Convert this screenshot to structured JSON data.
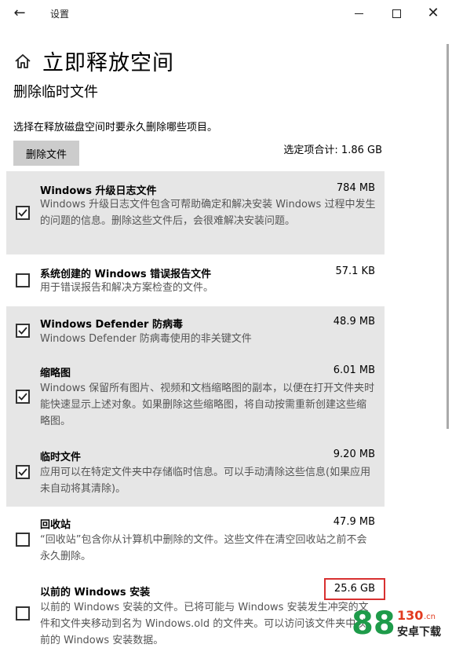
{
  "window": {
    "title": "设置",
    "back_glyph": "←",
    "close_glyph": "✕"
  },
  "page": {
    "title": "立即释放空间",
    "section": "删除临时文件",
    "instruction": "选择在释放磁盘空间时要永久删除哪些项目。",
    "delete_button": "删除文件",
    "total_label": "选定项合计: 1.86 GB"
  },
  "items": [
    {
      "name": "Windows 升级日志文件",
      "size": "784 MB",
      "checked": true,
      "description": "Windows 升级日志文件包含可帮助确定和解决安装 Windows 过程中发生的问题的信息。删除这些文件后，会很难解决安装问题。"
    },
    {
      "name": "系统创建的 Windows 错误报告文件",
      "size": "57.1 KB",
      "checked": false,
      "description": "用于错误报告和解决方案检查的文件。"
    },
    {
      "name": "Windows Defender 防病毒",
      "size": "48.9 MB",
      "checked": true,
      "description": "Windows Defender 防病毒使用的非关键文件"
    },
    {
      "name": "缩略图",
      "size": "6.01 MB",
      "checked": true,
      "description": "Windows 保留所有图片、视频和文档缩略图的副本，以便在打开文件夹时能快速显示上述对象。如果删除这些缩略图，将自动按需重新创建这些缩略图。"
    },
    {
      "name": "临时文件",
      "size": "9.20 MB",
      "checked": true,
      "description": "应用可以在特定文件夹中存储临时信息。可以手动清除这些信息(如果应用未自动将其清除)。"
    },
    {
      "name": "回收站",
      "size": "47.9 MB",
      "checked": false,
      "description": "“回收站”包含你从计算机中删除的文件。这些文件在清空回收站之前不会永久删除。"
    },
    {
      "name": "以前的 Windows 安装",
      "size": "25.6 GB",
      "checked": false,
      "description": "以前的 Windows 安装的文件。已将可能与 Windows 安装发生冲突的文件和文件夹移动到名为 Windows.old 的文件夹。可以访问该文件夹中以前的 Windows 安装数据。"
    }
  ],
  "watermark": {
    "number": "88",
    "small": "130",
    "tld": ".cn",
    "site": "安卓下载"
  },
  "colors": {
    "selected_row": "#e6e6e6",
    "highlight_border": "#d83030",
    "button_bg": "#cccccc",
    "watermark_green": "#1e9b4a",
    "watermark_red": "#e23a1f"
  }
}
